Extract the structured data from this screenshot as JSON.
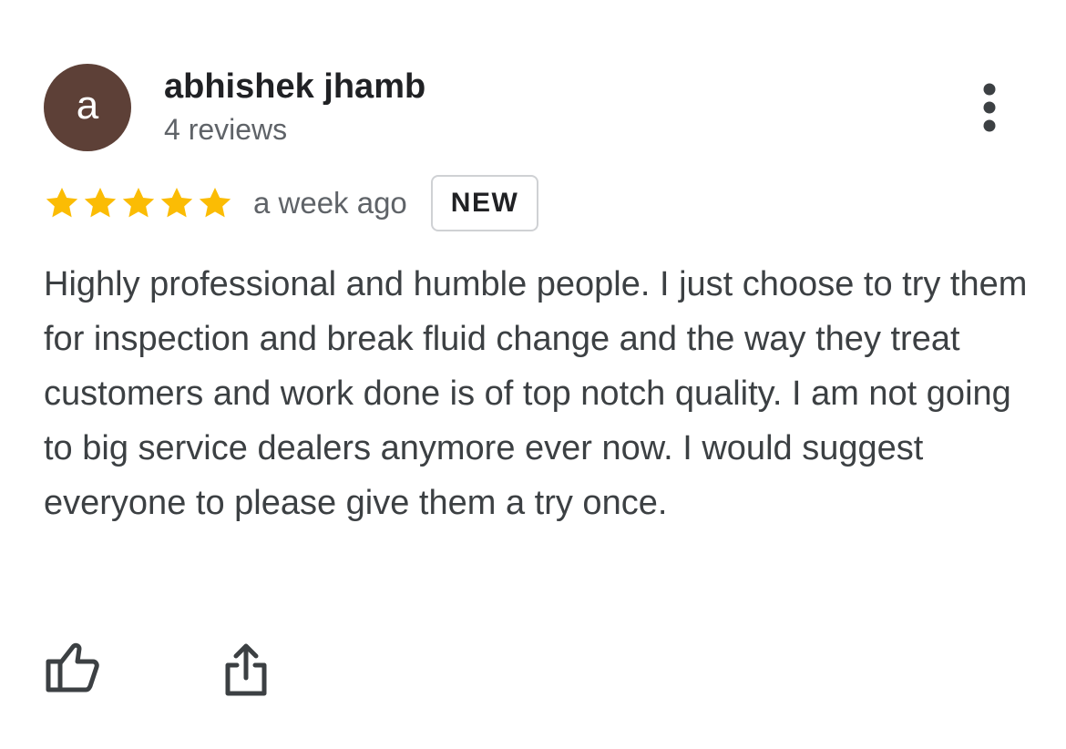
{
  "reviewer": {
    "avatar_letter": "a",
    "avatar_color": "#5d4037",
    "name": "abhishek jhamb",
    "review_count": "4 reviews"
  },
  "review": {
    "rating": 5,
    "rating_max": 5,
    "star_color": "#fbbc04",
    "date": "a week ago",
    "badge": "NEW",
    "text": "Highly professional and humble people. I just choose to try them for inspection and break fluid change and the way they treat customers and work done is of top notch quality. I am not going to big service dealers anymore ever now. I would suggest everyone to please give them a try once."
  },
  "icons": {
    "more": "more-vert-icon",
    "like": "thumbs-up-icon",
    "share": "share-icon",
    "star": "star-icon"
  }
}
